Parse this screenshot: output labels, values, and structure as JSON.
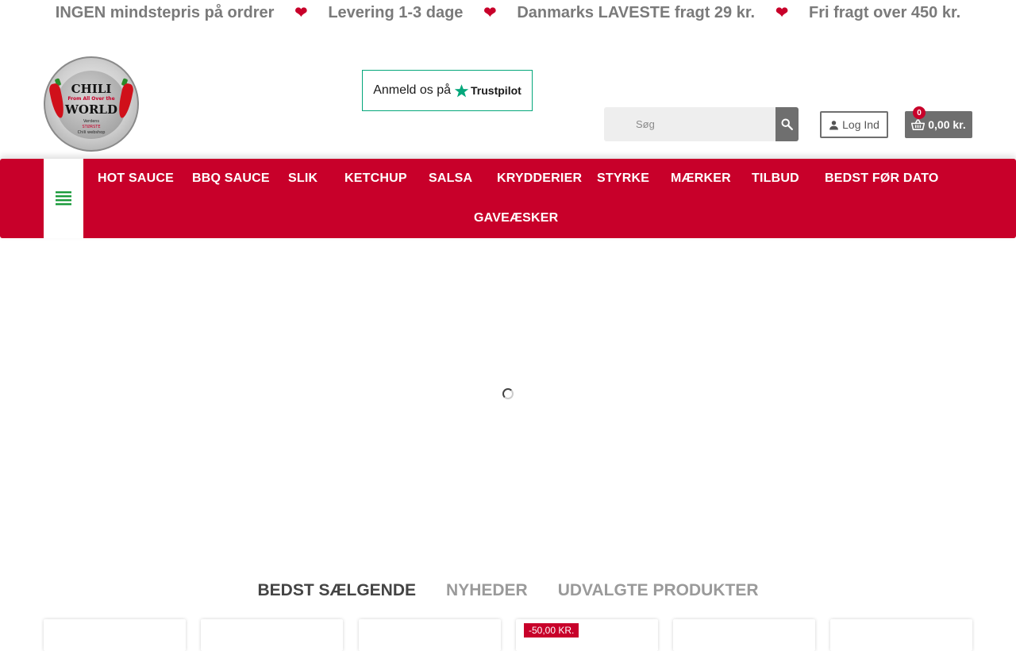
{
  "announcement": {
    "messages": [
      "INGEN mindstepris på ordrer",
      "Levering 1-3 dage",
      "Danmarks LAVESTE fragt 29 kr.",
      "Fri fragt over 450 kr."
    ],
    "separator": "❤"
  },
  "logo": {
    "line1": "CHILI",
    "line2": "From All Over the",
    "line3": "WORLD",
    "line4": "Verdens",
    "line5": "STØRSTE",
    "line6": "Chili webshop"
  },
  "trustpilot": {
    "label": "Anmeld os på",
    "brand": "Trustpilot"
  },
  "search": {
    "placeholder": "Søg"
  },
  "account": {
    "login_label": "Log Ind"
  },
  "cart": {
    "count": "0",
    "total": "0,00 kr."
  },
  "nav": {
    "items": [
      "HOT SAUCE",
      "BBQ SAUCE",
      "SLIK",
      "KETCHUP",
      "SALSA",
      "KRYDDERIER",
      "STYRKE",
      "MÆRKER",
      "TILBUD",
      "BEDST FØR DATO",
      "GAVEÆSKER"
    ]
  },
  "tabs": [
    "BEDST SÆLGENDE",
    "NYHEDER",
    "UDVALGTE PRODUKTER"
  ],
  "products": {
    "sale_badge": "-50,00 KR."
  },
  "colors": {
    "brand_red": "#c8002a",
    "gray_button": "#6f6f6f",
    "menu_icon_green": "#1a9a3a",
    "trustpilot_green": "#04a77b"
  }
}
